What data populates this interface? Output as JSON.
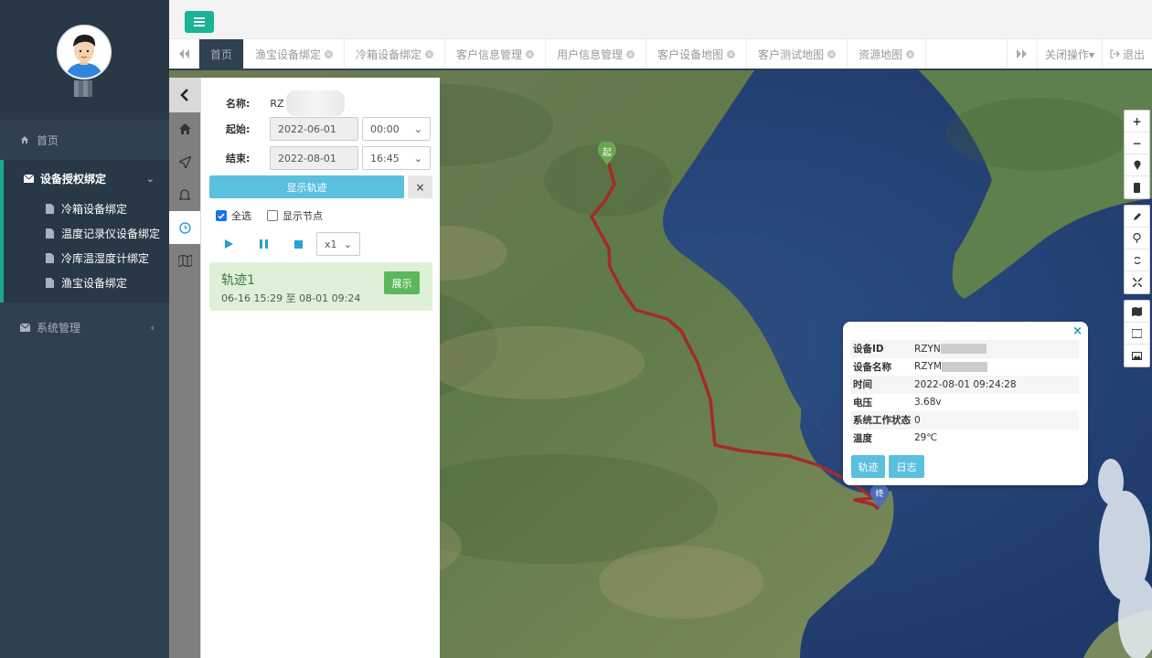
{
  "sidebar": {
    "home": "首页",
    "group_title": "设备授权绑定",
    "group_items": [
      "冷箱设备绑定",
      "温度记录仪设备绑定",
      "冷库温湿度计绑定",
      "渔宝设备绑定"
    ],
    "system": "系统管理"
  },
  "tabs": {
    "items": [
      "首页",
      "渔宝设备绑定",
      "冷箱设备绑定",
      "客户信息管理",
      "用户信息管理",
      "客户设备地图",
      "客户测试地图",
      "资源地图"
    ],
    "close_ops": "关闭操作▾",
    "logout": "退出"
  },
  "panel": {
    "name_label": "名称:",
    "name_value": "RZ",
    "start_label": "起始:",
    "start_date": "2022-06-01",
    "start_time": "00:00",
    "end_label": "结束:",
    "end_date": "2022-08-01",
    "end_time": "16:45",
    "show_track": "显示轨迹",
    "select_all": "全选",
    "show_nodes": "显示节点",
    "speed": "x1",
    "track_name": "轨迹1",
    "track_range": "06-16 15:29 至 08-01 09:24",
    "expand": "展示"
  },
  "map": {
    "start_marker": "起",
    "end_marker": "终",
    "route_color": "#a52a2a"
  },
  "popup": {
    "rows": [
      {
        "key": "设备ID",
        "value": "RZYN"
      },
      {
        "key": "设备名称",
        "value": "RZYM"
      },
      {
        "key": "时间",
        "value": "2022-08-01 09:24:28"
      },
      {
        "key": "电压",
        "value": "3.68v"
      },
      {
        "key": "系统工作状态",
        "value": "0"
      },
      {
        "key": "温度",
        "value": "29℃"
      }
    ],
    "btn_track": "轨迹",
    "btn_log": "日志"
  }
}
